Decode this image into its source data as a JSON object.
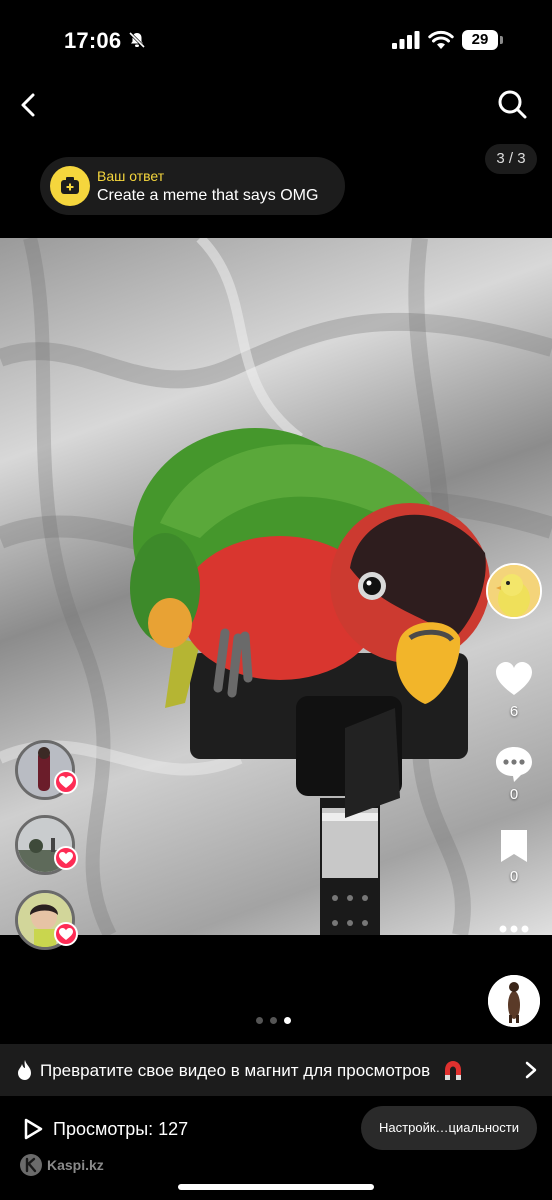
{
  "status_bar": {
    "time": "17:06",
    "battery": "29"
  },
  "prompt": {
    "title": "Ваш ответ",
    "subtitle": "Create a meme that says OMG"
  },
  "counter": "3 / 3",
  "actions": {
    "likes": "6",
    "comments": "0",
    "saves": "0"
  },
  "carousel": {
    "total": 3,
    "active": 3
  },
  "promo": {
    "text": "Превратите свое видео в магнит для просмотров"
  },
  "footer": {
    "views": "Просмотры: 127",
    "privacy_button": "Настройк…циальности"
  },
  "watermark": "Kaspi.kz",
  "colors": {
    "accent_yellow": "#f5d63d",
    "heart_red": "#fe2c55",
    "background": "#000000"
  },
  "icons": [
    "back-icon",
    "search-icon",
    "heart-icon",
    "comment-icon",
    "bookmark-icon",
    "more-icon",
    "play-icon",
    "fire-icon",
    "magnet-icon",
    "chevron-right-icon"
  ]
}
